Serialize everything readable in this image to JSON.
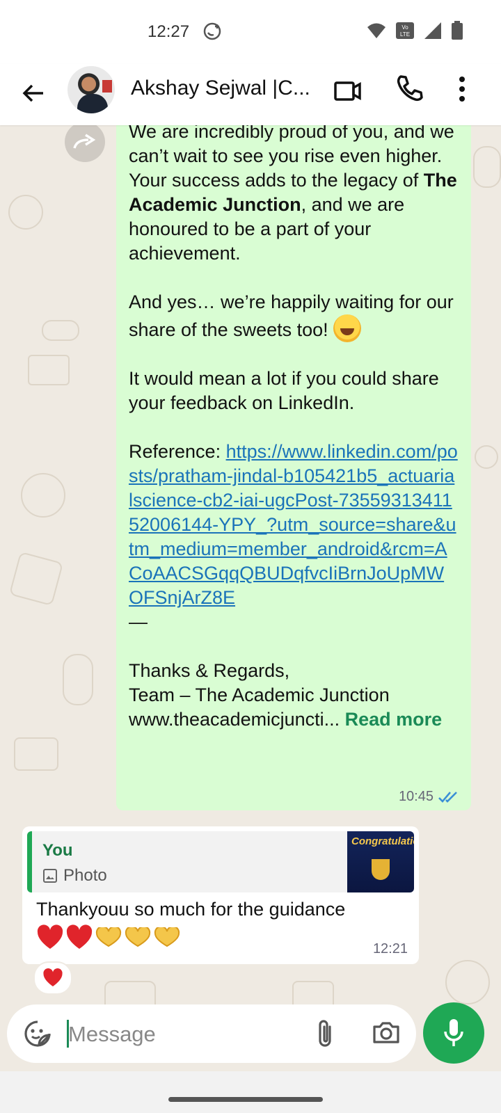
{
  "status_bar": {
    "time": "12:27",
    "icons": [
      "whatsapp-status-icon",
      "wifi-icon",
      "volte-icon",
      "signal-icon",
      "battery-icon"
    ]
  },
  "header": {
    "contact_name": "Akshay Sejwal |C...",
    "icons": [
      "back-arrow-icon",
      "video-call-icon",
      "phone-icon",
      "more-vert-icon"
    ]
  },
  "messages": {
    "outgoing": {
      "line1": "We are incredibly proud of you, and we can’t wait to see you rise even higher. Your success adds to the legacy of ",
      "bold1": "The Academic Junction",
      "line2": ", and we are honoured to be a part of your achievement.",
      "para2": "And yes… we’re happily waiting for our share of the sweets too! ",
      "para3": "It would mean a lot if you could share your feedback on LinkedIn.",
      "reference_label": "Reference: ",
      "reference_url": "https://www.linkedin.com/posts/pratham-jindal-b105421b5_actuarialscience-cb2-iai-ugcPost-7355931341152006144-YPY_?utm_source=share&utm_medium=member_android&rcm=ACoAACSGqqQBUDqfvcIiBrnJoUpMWOFSnjArZ8E",
      "dash": "—",
      "signoff": "Thanks & Regards,\nTeam – The Academic Junction\nwww.theacademicjuncti... ",
      "read_more": "Read more",
      "time": "10:45",
      "status": "read"
    },
    "incoming": {
      "quote_sender": "You",
      "quote_type": "Photo",
      "quote_thumb_title": "Congratulations",
      "text": "Thankyouu so much for the guidance",
      "emojis": [
        "red-heart",
        "red-heart",
        "heart-hands",
        "heart-hands",
        "heart-hands"
      ],
      "time": "12:21",
      "reaction": "red-heart"
    }
  },
  "composer": {
    "placeholder": "Message",
    "icons": [
      "sticker-icon",
      "attach-icon",
      "camera-icon",
      "mic-icon"
    ]
  },
  "colors": {
    "outgoing_bubble": "#d9fdd3",
    "accent_green": "#1fa855",
    "link_blue": "#1a73b9",
    "chat_background": "#efeae2"
  }
}
